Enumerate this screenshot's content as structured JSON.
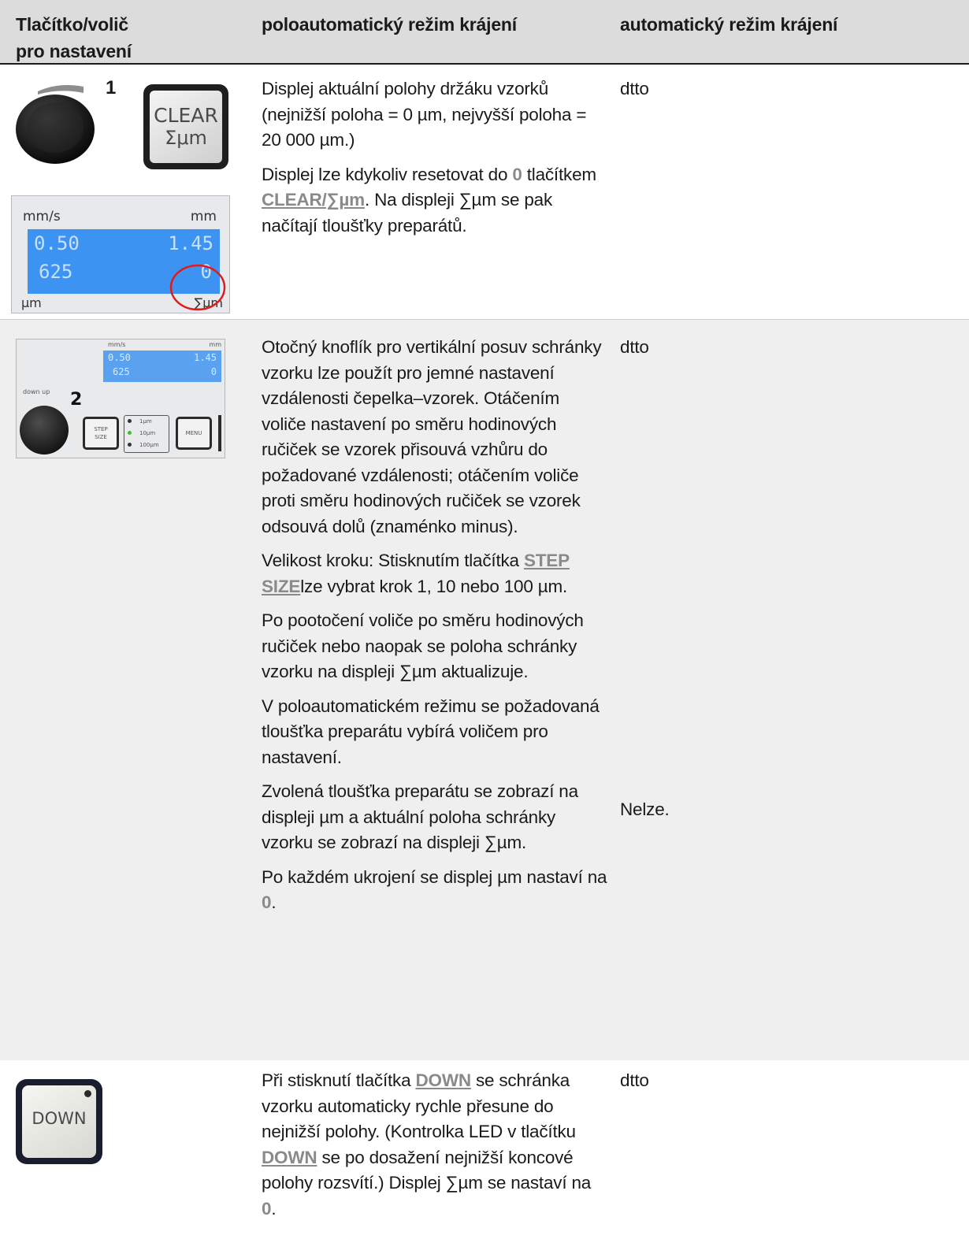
{
  "header": {
    "col1": "Tlačítko/volič pro nastavení",
    "col1_line1": "Tlačítko/volič",
    "col1_line2": "pro nastavení",
    "col2": "poloautomatický režim krájení",
    "col3": "automatický režim krájení"
  },
  "rows": [
    {
      "callout": "1",
      "clear_key": {
        "line1": "CLEAR",
        "line2": "Σμm"
      },
      "display": {
        "unit_tl": "mm/s",
        "unit_tr": "mm",
        "val_tl": "0.50",
        "val_tr": "1.45",
        "val_bl": "625",
        "val_br": "0",
        "unit_bl": "µm",
        "unit_br": "∑µm"
      },
      "semi": [
        {
          "t1": "Displej aktuální polohy držáku vzorků (nejnižší poloha = 0 µm, nejvyšší poloha = 20 000 µm.)"
        },
        {
          "t1": "Displej lze kdykoliv resetovat do ",
          "k1": "0",
          "t2": " tlačítkem ",
          "k2": "CLEAR/∑µm",
          "t3": ". Na displeji ∑µm se pak načítají tloušťky preparátů."
        }
      ],
      "auto": "dtto"
    },
    {
      "callout": "2",
      "panel": {
        "unit_tl": "mm/s",
        "unit_tr": "mm",
        "val_tl": "0.50",
        "val_tr": "1.45",
        "val_bl": "625",
        "val_br": "0",
        "step_key": "STEP SIZE",
        "step_line1": "STEP",
        "step_line2": "SIZE",
        "steps": [
          "1µm",
          "10µm",
          "100µm"
        ],
        "menu_key": "MENU",
        "knob_label": "down  up"
      },
      "semi": [
        {
          "t1": "Otočný knoflík pro vertikální posuv schránky vzorku lze použít pro jemné nastavení vzdálenosti čepelka–vzorek. Otáčením voliče nastavení po směru hodinových ručiček se vzorek přisouvá vzhůru do požadované vzdálenosti; otáčením voliče proti směru hodinových ručiček se vzorek odsouvá dolů (znaménko minus)."
        },
        {
          "t1": "Velikost kroku: Stisknutím tlačítka ",
          "k1": "STEP SIZE",
          "t2": "lze vybrat krok 1, 10 nebo 100 µm."
        },
        {
          "t1": "Po pootočení voliče po směru hodinových ručiček nebo naopak se poloha schránky vzorku na displeji ∑µm aktualizuje."
        },
        {
          "t1": "V poloautomatickém režimu se požadovaná tloušťka preparátu vybírá voličem pro nastavení."
        },
        {
          "t1": "Zvolená tloušťka preparátu se zobrazí na displeji µm a aktuální poloha schránky vzorku se zobrazí na displeji ∑µm."
        },
        {
          "t1": "Po každém ukrojení se displej µm nastaví na ",
          "k1": "0",
          "t2": "."
        }
      ],
      "auto": "dtto",
      "auto2": "Nelze."
    },
    {
      "down_key": "DOWN",
      "semi": [
        {
          "t1": "Při stisknutí tlačítka ",
          "k1": "DOWN",
          "t2": " se schránka vzorku automaticky rychle přesune do nejnižší polohy. (Kontrolka LED v tlačítku ",
          "k2": "DOWN",
          "t3": " se po dosažení nejnižší koncové polohy rozsvítí.) Displej ∑µm se nastaví na ",
          "k3": "0",
          "t4": "."
        }
      ],
      "auto": "dtto"
    }
  ]
}
